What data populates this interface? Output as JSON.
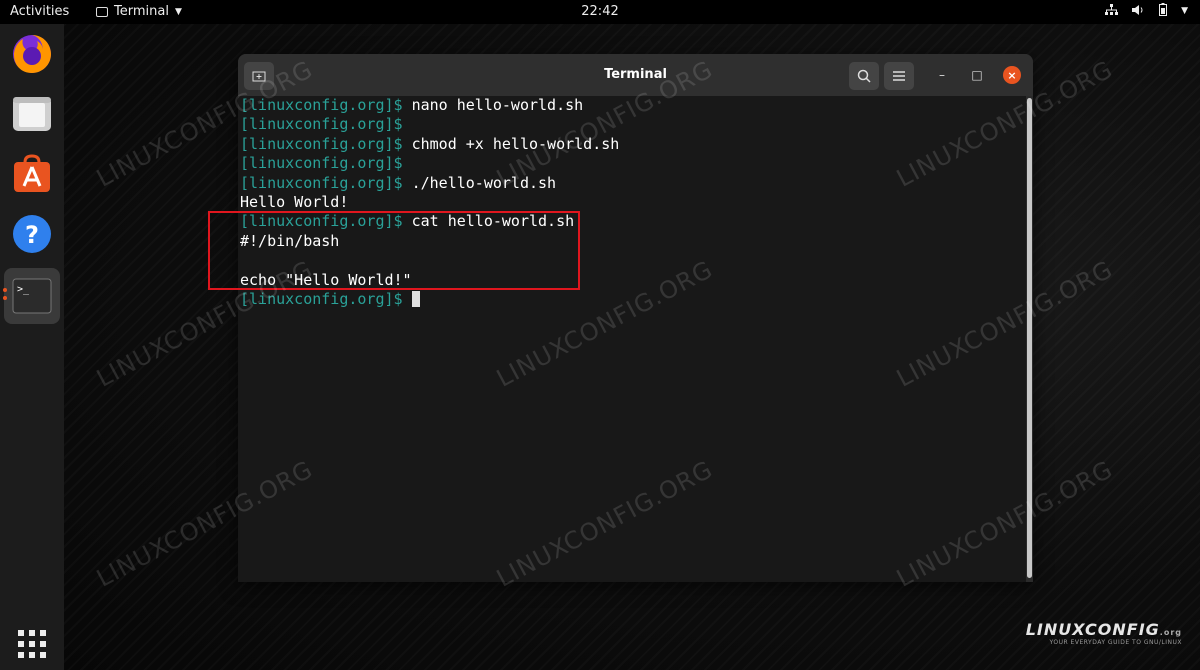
{
  "topbar": {
    "activities": "Activities",
    "app_menu": "Terminal",
    "clock": "22:42",
    "icons": [
      "network-icon",
      "volume-icon",
      "battery-icon",
      "chevron-down-icon"
    ]
  },
  "dock": {
    "items": [
      "firefox",
      "files",
      "software",
      "help",
      "terminal"
    ],
    "active": "terminal"
  },
  "window": {
    "title": "Terminal",
    "new_tab_icon": "new-tab-icon",
    "search_icon": "search-icon",
    "menu_icon": "hamburger-menu-icon",
    "minimize": "–",
    "maximize": "□",
    "close": "×"
  },
  "terminal": {
    "prompt": "[linuxconfig.org]$",
    "lines": [
      {
        "prompt": "[linuxconfig.org]$",
        "cmd": " nano hello-world.sh"
      },
      {
        "prompt": "[linuxconfig.org]$",
        "cmd": ""
      },
      {
        "prompt": "[linuxconfig.org]$",
        "cmd": " chmod +x hello-world.sh"
      },
      {
        "prompt": "[linuxconfig.org]$",
        "cmd": ""
      },
      {
        "prompt": "[linuxconfig.org]$",
        "cmd": " ./hello-world.sh"
      },
      {
        "prompt": "",
        "cmd": "Hello World!"
      },
      {
        "prompt": "[linuxconfig.org]$",
        "cmd": " cat hello-world.sh"
      },
      {
        "prompt": "",
        "cmd": "#!/bin/bash"
      },
      {
        "prompt": "",
        "cmd": ""
      },
      {
        "prompt": "",
        "cmd": "echo \"Hello World!\""
      },
      {
        "prompt": "[linuxconfig.org]$",
        "cmd": " "
      }
    ]
  },
  "watermark": "LINUXCONFIG.ORG",
  "brand": {
    "name": "LINUXCONFIG",
    "suffix": ".org",
    "tagline": "YOUR EVERYDAY GUIDE TO GNU/LINUX"
  },
  "colors": {
    "prompt": "#2aa198",
    "highlight_box": "#e0161e",
    "accent": "#e95420"
  }
}
